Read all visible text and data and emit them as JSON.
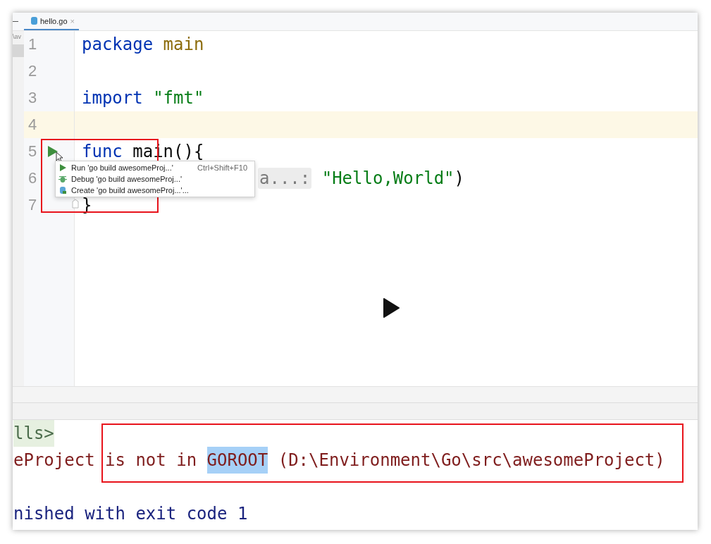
{
  "tab": {
    "label": "hello.go",
    "close": "×"
  },
  "side_panel": {
    "text": "\\av"
  },
  "editor": {
    "lines": [
      {
        "number": "1",
        "current": false,
        "tokens": [
          {
            "text": "package",
            "kind": "keyword"
          },
          {
            "text": " main",
            "kind": "package"
          }
        ]
      },
      {
        "number": "2",
        "current": false
      },
      {
        "number": "3",
        "current": false,
        "tokens": [
          {
            "text": "import",
            "kind": "keyword"
          },
          {
            "text": " \"fmt\"",
            "kind": "string"
          }
        ]
      },
      {
        "number": "4",
        "current": true
      },
      {
        "number": "5",
        "current": false,
        "tokens": [
          {
            "text": "func",
            "kind": "keyword"
          },
          {
            "text": " main(){",
            "kind": "plain"
          }
        ]
      },
      {
        "number": "6",
        "current": false,
        "tokens": [
          {
            "text": "a...:",
            "kind": "hint"
          },
          {
            "text": " \"Hello,World\"",
            "kind": "string"
          },
          {
            "text": ")",
            "kind": "plain"
          }
        ]
      },
      {
        "number": "7",
        "current": false,
        "tokens": [
          {
            "text": "}",
            "kind": "plain"
          }
        ]
      }
    ]
  },
  "run_popup": {
    "items": [
      {
        "label": "Run 'go build awesomeProj...'",
        "shortcut": "Ctrl+Shift+F10",
        "kind": "run"
      },
      {
        "label": "Debug 'go build awesomeProj...'",
        "kind": "debug"
      },
      {
        "label": "Create 'go build awesomeProj...'...",
        "kind": "create"
      }
    ]
  },
  "console": {
    "lines": [
      {
        "blank_before": false,
        "tokens": [
          {
            "text": "lls>",
            "kind": "prompt"
          }
        ]
      },
      {
        "blank_before": false,
        "tokens": [
          {
            "text": "eProject ",
            "kind": "error"
          },
          {
            "text": "is not in ",
            "kind": "error"
          },
          {
            "text": "GOROOT",
            "kind": "selected"
          },
          {
            "text": " (D:\\Environment\\Go\\src\\awesomeProject)",
            "kind": "error"
          }
        ]
      },
      {
        "blank_before": true,
        "tokens": [
          {
            "text": "nished with exit code 1",
            "kind": "info"
          }
        ]
      }
    ]
  }
}
